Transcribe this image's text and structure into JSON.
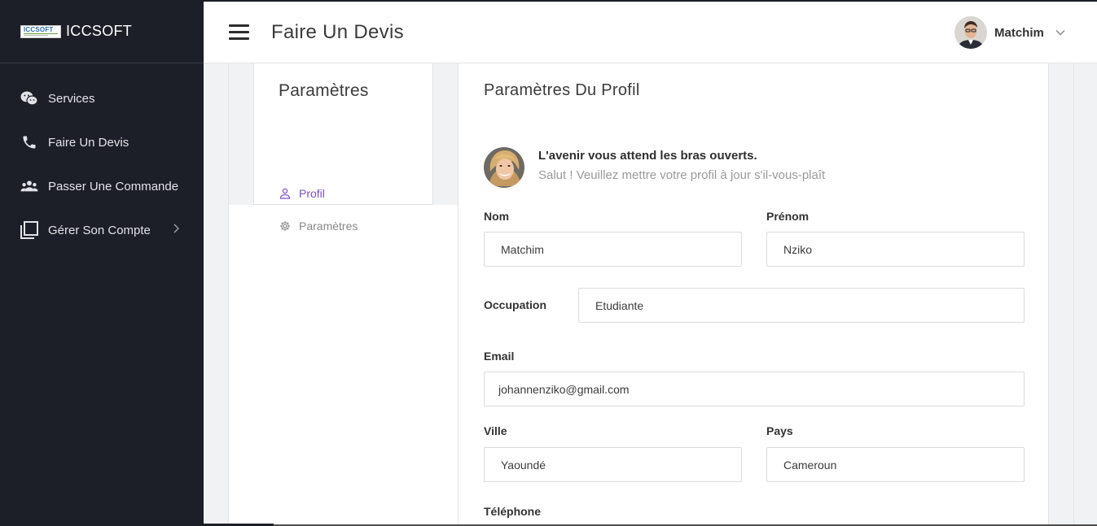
{
  "app": {
    "logo_text": "ICCSOFT",
    "brand_name": "ICCSOFT"
  },
  "sidebar": {
    "items": [
      {
        "label": "Services",
        "icon": "wechat-icon"
      },
      {
        "label": "Faire Un Devis",
        "icon": "phone-icon"
      },
      {
        "label": "Passer Une Commande",
        "icon": "people-icon"
      },
      {
        "label": "Gérer Son Compte",
        "icon": "window-icon"
      }
    ]
  },
  "header": {
    "title": "Faire Un Devis",
    "user_name": "Matchim"
  },
  "settings_menu": {
    "title": "Paramètres",
    "items": [
      {
        "label": "Profil",
        "icon": "user-icon"
      },
      {
        "label": "Paramètres",
        "icon": "gear-icon"
      }
    ]
  },
  "profile": {
    "title": "Paramètres Du Profil",
    "welcome_heading": "L'avenir vous attend les bras ouverts.",
    "welcome_text": "Salut ! Veuillez mettre votre profil à jour s'il-vous-plaît",
    "fields": {
      "nom": {
        "label": "Nom",
        "value": "Matchim"
      },
      "prenom": {
        "label": "Prénom",
        "value": "Nziko"
      },
      "occupation": {
        "label": "Occupation",
        "value": "Etudiante"
      },
      "email": {
        "label": "Email",
        "value": "johannenziko@gmail.com"
      },
      "ville": {
        "label": "Ville",
        "value": "Yaoundé"
      },
      "pays": {
        "label": "Pays",
        "value": "Cameroun"
      },
      "telephone": {
        "label": "Téléphone"
      }
    }
  },
  "colors": {
    "sidebar_bg": "#1d1f28",
    "accent_purple": "#7b4fc9",
    "page_bg": "#f1f2f4"
  }
}
